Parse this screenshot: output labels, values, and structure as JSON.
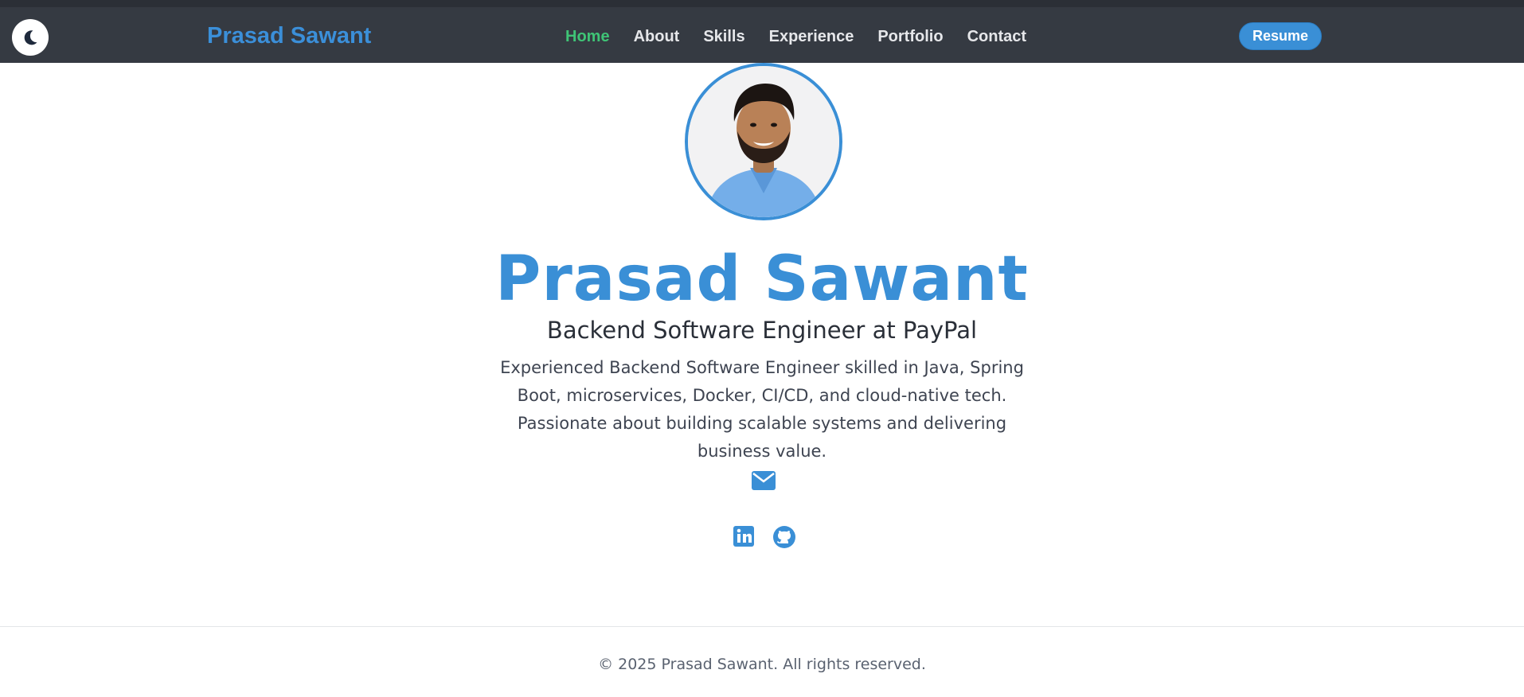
{
  "nav": {
    "brand": "Prasad Sawant",
    "links": [
      "Home",
      "About",
      "Skills",
      "Experience",
      "Portfolio",
      "Contact"
    ],
    "active_index": 0,
    "resume_label": "Resume",
    "theme_icon": "moon-icon"
  },
  "hero": {
    "avatar_alt": "profile-photo",
    "name": "Prasad Sawant",
    "role": "Backend Software Engineer at PayPal",
    "description": "Experienced Backend Software Engineer skilled in Java, Spring Boot, microservices, Docker, CI/CD, and cloud-native tech. Passionate about building scalable systems and delivering business value."
  },
  "social": {
    "email_icon": "envelope-icon",
    "linkedin_icon": "linkedin-icon",
    "github_icon": "github-icon"
  },
  "footer": {
    "text": "© 2025 Prasad Sawant. All rights reserved."
  },
  "colors": {
    "accent": "#3a8fd6",
    "nav_bg": "#353a42",
    "active_link": "#3fc476"
  }
}
